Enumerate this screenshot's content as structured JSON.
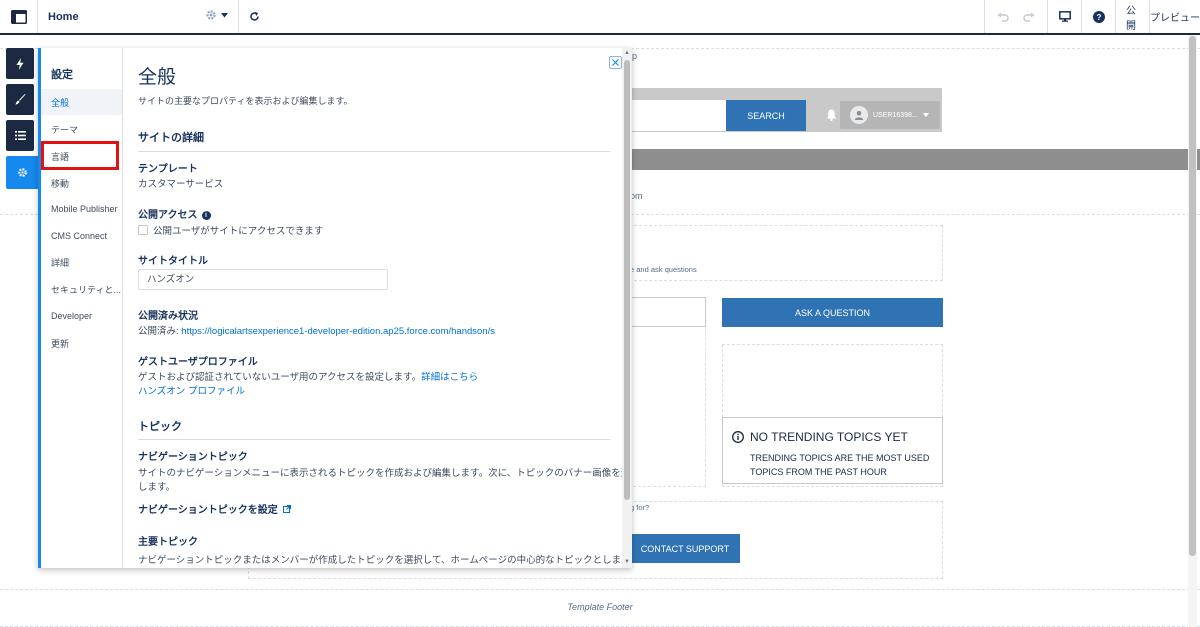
{
  "topbar": {
    "page_name": "Home",
    "publish_label": "公開",
    "preview_label": "プレビュー"
  },
  "background": {
    "frag_top": "p",
    "search_label": "SEARCH",
    "user_name": "USER16398...",
    "frag_com": "om",
    "frag_ask": "e and ask questions",
    "ask_button": "ASK A QUESTION",
    "trending_title": "NO TRENDING TOPICS YET",
    "trending_line1": "TRENDING TOPICS ARE THE MOST USED",
    "trending_line2": "TOPICS FROM THE PAST HOUR",
    "frag_looking": "g for?",
    "contact_button": "CONTACT SUPPORT",
    "footer_label": "Template Footer"
  },
  "settings_nav": {
    "title": "設定",
    "items": [
      {
        "label": "全般"
      },
      {
        "label": "テーマ"
      },
      {
        "label": "言語"
      },
      {
        "label": "移動"
      },
      {
        "label": "Mobile Publisher"
      },
      {
        "label": "CMS Connect"
      },
      {
        "label": "詳細"
      },
      {
        "label": "セキュリティと..."
      },
      {
        "label": "Developer"
      },
      {
        "label": "更新"
      }
    ]
  },
  "general": {
    "title": "全般",
    "description": "サイトの主要なプロパティを表示および編集します。",
    "site_details_heading": "サイトの詳細",
    "template_label": "テンプレート",
    "template_value": "カスタマーサービス",
    "public_access_label": "公開アクセス",
    "public_access_checkbox": "公開ユーザがサイトにアクセスできます",
    "site_title_label": "サイトタイトル",
    "site_title_value": "ハンズオン",
    "published_status_label": "公開済み状況",
    "published_prefix": "公開済み: ",
    "published_url": "https://logicalartsexperience1-developer-edition.ap25.force.com/handson/s",
    "guest_profile_label": "ゲストユーザプロファイル",
    "guest_profile_desc": "ゲストおよび認証されていないユーザ用のアクセスを設定します。",
    "guest_profile_more": "詳細はこちら",
    "guest_profile_link": "ハンズオン プロファイル",
    "topics_heading": "トピック",
    "nav_topics_label": "ナビゲーショントピック",
    "nav_topics_desc1": "サイトのナビゲーションメニューに表示されるトピックを作成および編集します。次に、トピックのバナー画像を選択",
    "nav_topics_desc2": "します。",
    "nav_topics_setup": "ナビゲーショントピックを設定",
    "featured_topics_label": "主要トピック",
    "featured_topics_desc": "ナビゲーショントピックまたはメンバーが作成したトピックを選択して、ホームページの中心的なトピックとします。"
  }
}
